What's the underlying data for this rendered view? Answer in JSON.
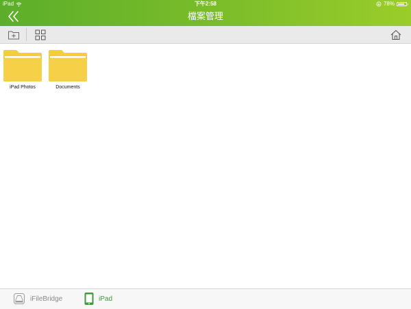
{
  "status_bar": {
    "device": "iPad",
    "time": "下午2:58",
    "battery_text": "78%",
    "battery_level": 0.78
  },
  "nav": {
    "title": "檔案管理",
    "back_icon": "double-chevron-left-icon"
  },
  "toolbar": {
    "icons": [
      "new-folder-icon",
      "grid-view-icon",
      "home-icon"
    ]
  },
  "folders": [
    {
      "name": "iPad Photos",
      "icon": "folder-icon"
    },
    {
      "name": "Documents",
      "icon": "folder-icon"
    }
  ],
  "tabs": [
    {
      "label": "iFileBridge",
      "icon": "drive-icon",
      "active": false
    },
    {
      "label": "iPad",
      "icon": "ipad-icon",
      "active": true
    }
  ],
  "colors": {
    "header_start": "#5cae2a",
    "header_end": "#9acd2a",
    "folder": "#f4cd3c",
    "active_tab": "#3f9a3a",
    "inactive_tab": "#8a8a8a"
  }
}
